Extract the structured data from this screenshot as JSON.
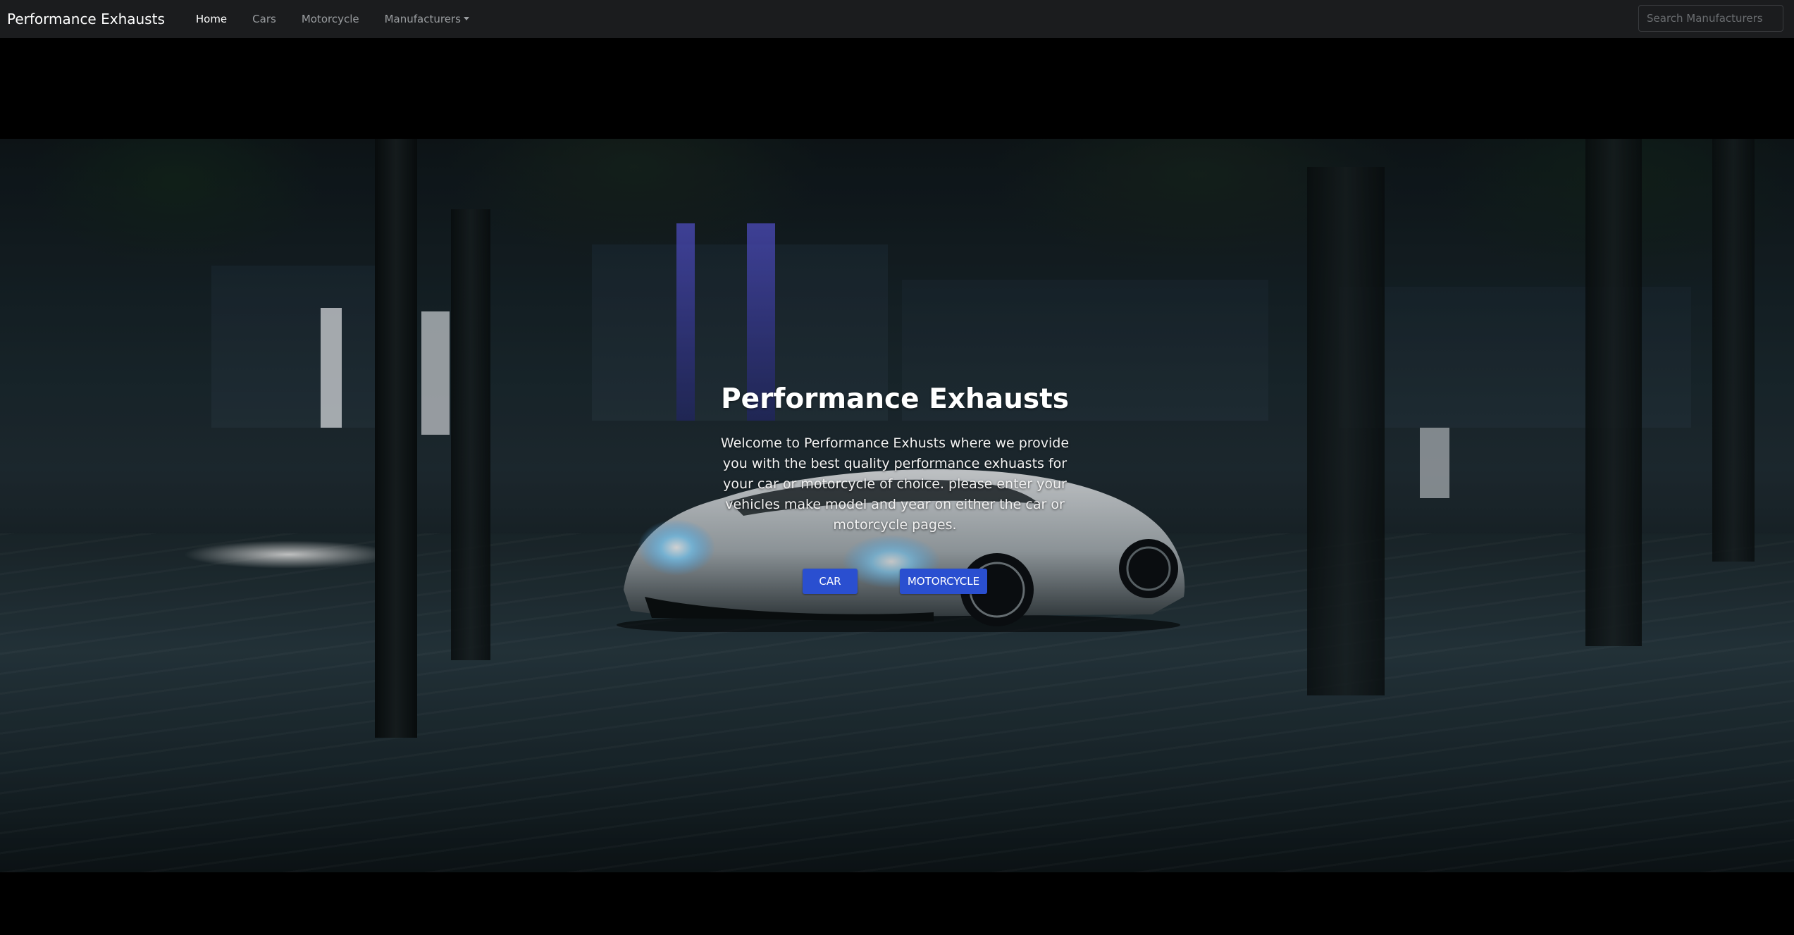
{
  "navbar": {
    "brand": "Performance Exhausts",
    "links": [
      {
        "label": "Home",
        "active": true
      },
      {
        "label": "Cars",
        "active": false
      },
      {
        "label": "Motorcycle",
        "active": false
      },
      {
        "label": "Manufacturers",
        "active": false,
        "dropdown": true
      }
    ],
    "search_placeholder": "Search Manufacturers"
  },
  "hero": {
    "title": "Performance Exhausts",
    "text": "Welcome to Performance Exhusts where we provide you with the best quality performance exhuasts for your car or motorcycle of choice. please enter your vehicles make model and year on either the car or motorcycle pages.",
    "buttons": {
      "car_label": "CAR",
      "motorcycle_label": "MOTORCYCLE"
    }
  },
  "colors": {
    "navbar_bg": "#1b1c1e",
    "button_primary": "#2a4fd0",
    "page_bg": "#000000"
  }
}
